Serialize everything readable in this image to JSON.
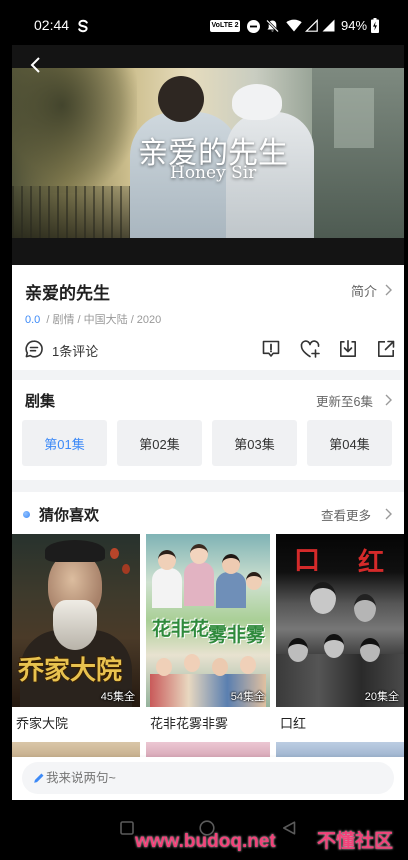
{
  "status_bar": {
    "time": "02:44",
    "network_badge": "VoLTE 2",
    "battery_percent": "94%",
    "icons": [
      "app-notification-icon",
      "do-not-disturb-icon",
      "mute-icon",
      "wifi-icon",
      "signal-icon",
      "signal-icon",
      "battery-charging-icon"
    ]
  },
  "player": {
    "back_icon": "chevron-left-icon",
    "poster_title": "亲爱的先生",
    "poster_subtitle": "Honey Sir"
  },
  "detail": {
    "title": "亲爱的先生",
    "intro_link": "简介",
    "score": "0.0",
    "meta": "/ 剧情 / 中国大陆 / 2020",
    "comments": "1条评论",
    "comment_icon": "comment-icon",
    "actions": [
      {
        "name": "report",
        "icon": "report-icon"
      },
      {
        "name": "favorite",
        "icon": "heart-plus-icon"
      },
      {
        "name": "download",
        "icon": "download-icon"
      },
      {
        "name": "share",
        "icon": "share-icon"
      }
    ]
  },
  "episodes": {
    "title": "剧集",
    "update_status": "更新至6集",
    "items": [
      {
        "label": "第01集",
        "selected": true
      },
      {
        "label": "第02集",
        "selected": false
      },
      {
        "label": "第03集",
        "selected": false
      },
      {
        "label": "第04集",
        "selected": false
      }
    ]
  },
  "recommend": {
    "title": "猜你喜欢",
    "more_link": "查看更多",
    "items": [
      {
        "title": "乔家大院",
        "badge": "45集全",
        "poster_art": "乔家大院"
      },
      {
        "title": "花非花雾非雾",
        "badge": "54集全",
        "poster_art": [
          "花非花",
          "雾非雾"
        ]
      },
      {
        "title": "口红",
        "badge": "20集全",
        "poster_art": [
          "口",
          "红"
        ]
      }
    ]
  },
  "comment_input": {
    "placeholder": "我来说两句~",
    "icon": "pencil-icon"
  },
  "nav_bar": {
    "icons": [
      "recent-apps-icon",
      "home-icon",
      "back-icon"
    ]
  },
  "watermark": {
    "site": "www.budoq.net",
    "name": "不懂社区"
  },
  "colors": {
    "accent": "#3d8af7",
    "text": "#222222",
    "secondary": "#999999",
    "divider": "#f2f3f5",
    "watermark": "#f2437a"
  }
}
